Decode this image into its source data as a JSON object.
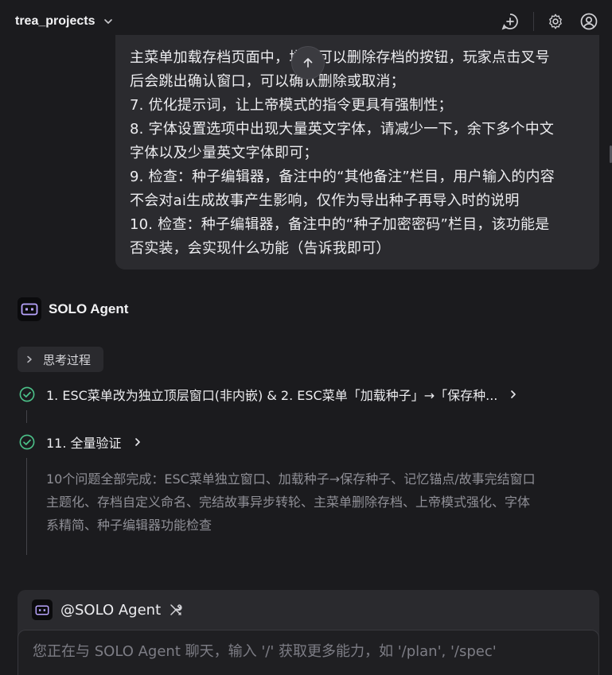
{
  "header": {
    "project_name": "trea_projects",
    "icons": [
      "chevron-down-icon",
      "new-chat-icon",
      "settings-icon",
      "account-icon"
    ]
  },
  "user_message": {
    "lines": [
      "主菜单加载存档页面中，增加可以删除存档的按钮，玩家点击叉号",
      "后会跳出确认窗口，可以确认删除或取消；",
      "7. 优化提示词，让上帝模式的指令更具有强制性；",
      "8. 字体设置选项中出现大量英文字体，请减少一下，余下多个中文",
      "字体以及少量英文字体即可；",
      "9. 检查：种子编辑器，备注中的“其他备注”栏目，用户输入的内容",
      "不会对ai生成故事产生影响，仅作为导出种子再导入时的说明",
      "10. 检查：种子编辑器，备注中的“种子加密密码”栏目，该功能是",
      "否实装，会实现什么功能（告诉我即可）"
    ]
  },
  "agent": {
    "name": "SOLO Agent",
    "thinking_label": "思考过程",
    "steps": [
      {
        "label": "1. ESC菜单改为独立顶层窗口(非内嵌) & 2. ESC菜单「加载种子」→「保存种...",
        "status": "done"
      },
      {
        "label": "11. 全量验证",
        "status": "done"
      }
    ],
    "summary_lines": [
      "10个问题全部完成：ESC菜单独立窗口、加载种子→保存种子、记忆锚点/故事完结窗口",
      "主题化、存档自定义命名、完结故事异步转轮、主菜单删除存档、上帝模式强化、字体",
      "系精简、种子编辑器功能检查"
    ]
  },
  "composer": {
    "mention": "@SOLO Agent",
    "placeholder": "您正在与 SOLO Agent 聊天，输入 '/' 获取更多能力，如 '/plan', '/spec'"
  },
  "colors": {
    "background": "#1b1b1e",
    "bubble": "#2b2b2f",
    "success": "#4cc38a",
    "muted_text": "#8f8f96"
  }
}
